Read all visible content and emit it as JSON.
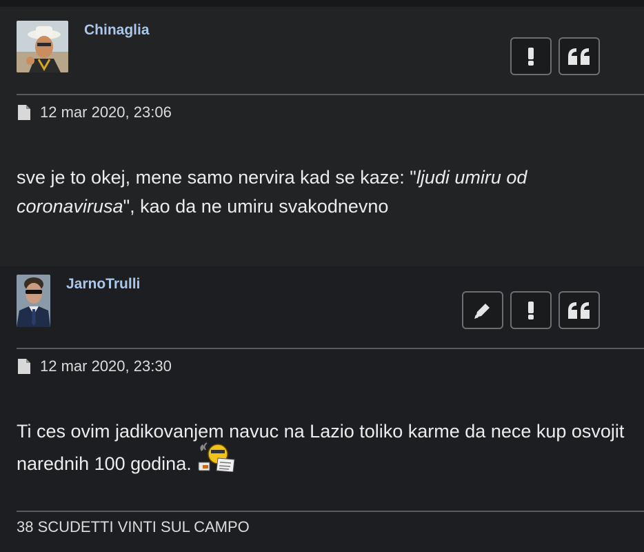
{
  "posts": [
    {
      "username": "Chinaglia",
      "date": "12 mar 2020, 23:06",
      "content_plain_1": "sve je to okej, mene samo nervira kad se kaze: \"",
      "content_italic": "ljudi umiru od coronavirusa",
      "content_plain_2": "\", kao da ne umiru svakodnevno",
      "buttons": [
        "report",
        "quote"
      ],
      "avatar_icon": "avatar-hat-man"
    },
    {
      "username": "JarnoTrulli",
      "date": "12 mar 2020, 23:30",
      "content": "Ti ces ovim jadikovanjem navuc na Lazio toliko karme da nece kup osvojit narednih 100 godina.",
      "smiley_icon": "reading-newspaper-smiley",
      "signature": "38 SCUDETTI VINTI SUL CAMPO",
      "buttons": [
        "edit",
        "report",
        "quote"
      ],
      "avatar_icon": "avatar-suit-man"
    }
  ],
  "colors": {
    "username": "#a9c7ea",
    "background": "#1e1f21",
    "button_border": "#6d6e70"
  }
}
